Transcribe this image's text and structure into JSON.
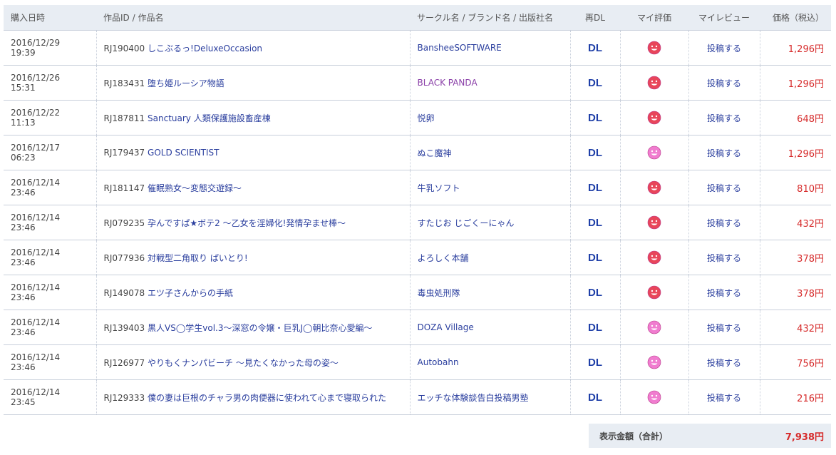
{
  "headers": {
    "date": "購入日時",
    "work": "作品ID / 作品名",
    "circle": "サークル名 / ブランド名 / 出版社名",
    "redl": "再DL",
    "rating": "マイ評価",
    "review": "マイレビュー",
    "price": "価格（税込）"
  },
  "rows": [
    {
      "date1": "2016/12/29",
      "date2": "19:39",
      "id": "RJ190400",
      "title": "しこぶるっ!DeluxeOccasion",
      "circle": "BansheeSOFTWARE",
      "dl": "DL",
      "face": "red",
      "review": "投稿する",
      "price": "1,296円"
    },
    {
      "date1": "2016/12/26",
      "date2": "15:31",
      "id": "RJ183431",
      "title": "堕ち姫ルーシア物語",
      "circle": "BLACK PANDA",
      "dl": "DL",
      "face": "red",
      "review": "投稿する",
      "price": "1,296円"
    },
    {
      "date1": "2016/12/22",
      "date2": "11:13",
      "id": "RJ187811",
      "title": "Sanctuary 人類保護施設畜産棟",
      "circle": "悦卵",
      "dl": "DL",
      "face": "red",
      "review": "投稿する",
      "price": "648円"
    },
    {
      "date1": "2016/12/17",
      "date2": "06:23",
      "id": "RJ179437",
      "title": "GOLD SCIENTIST",
      "circle": "ぬこ魔神",
      "dl": "DL",
      "face": "pink",
      "review": "投稿する",
      "price": "1,296円"
    },
    {
      "date1": "2016/12/14",
      "date2": "23:46",
      "id": "RJ181147",
      "title": "催眠熟女～変態交遊録～",
      "circle": "牛乳ソフト",
      "dl": "DL",
      "face": "red",
      "review": "投稿する",
      "price": "810円"
    },
    {
      "date1": "2016/12/14",
      "date2": "23:46",
      "id": "RJ079235",
      "title": "孕んですぱ★ボテ2 ～乙女を淫婦化!発情孕ませ棒～",
      "circle": "すたじお じごくーにゃん",
      "dl": "DL",
      "face": "red",
      "review": "投稿する",
      "price": "432円"
    },
    {
      "date1": "2016/12/14",
      "date2": "23:46",
      "id": "RJ077936",
      "title": "対戦型二角取り ぱいとり!",
      "circle": "よろしく本舗",
      "dl": "DL",
      "face": "red",
      "review": "投稿する",
      "price": "378円"
    },
    {
      "date1": "2016/12/14",
      "date2": "23:46",
      "id": "RJ149078",
      "title": "エツ子さんからの手紙",
      "circle": "毒虫処刑隊",
      "dl": "DL",
      "face": "red",
      "review": "投稿する",
      "price": "378円"
    },
    {
      "date1": "2016/12/14",
      "date2": "23:46",
      "id": "RJ139403",
      "title": "黒人VS◯学生vol.3～深窓の令嬢・巨乳J◯朝比奈心愛編～",
      "circle": "DOZA Village",
      "dl": "DL",
      "face": "pink",
      "review": "投稿する",
      "price": "432円"
    },
    {
      "date1": "2016/12/14",
      "date2": "23:46",
      "id": "RJ126977",
      "title": "やりもくナンパビーチ ～見たくなかった母の姿～",
      "circle": "Autobahn",
      "dl": "DL",
      "face": "pink",
      "review": "投稿する",
      "price": "756円"
    },
    {
      "date1": "2016/12/14",
      "date2": "23:45",
      "id": "RJ129333",
      "title": "僕の妻は巨根のチャラ男の肉便器に使われて心まで寝取られた",
      "circle": "エッチな体験談告白投稿男塾",
      "dl": "DL",
      "face": "pink",
      "review": "投稿する",
      "price": "216円"
    }
  ],
  "total": {
    "label": "表示金額（合計）",
    "amount": "7,938円"
  },
  "colors": {
    "face_red": "#e8455a",
    "face_pink": "#f07ccf",
    "price": "#d62b2b",
    "link": "#2a3e9e",
    "header_bg": "#e8edf3"
  }
}
